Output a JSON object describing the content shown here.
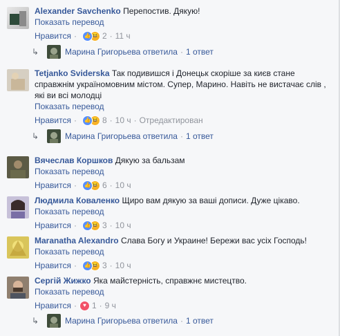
{
  "comments": [
    {
      "author": "Alexander Savchenko",
      "text": "Перепостив. Дякую!",
      "translate": "Показать перевод",
      "like": "Нравится",
      "reactions": [
        "like",
        "haha"
      ],
      "count": "2",
      "time": "11 ч",
      "edited": "",
      "reply": {
        "name": "Марина Григорьева ответила",
        "count": "1 ответ"
      }
    },
    {
      "author": "Tetjanko Sviderska",
      "text": "Так подивишся і Донецьк скоріше за києв стане справжнім україномовним містом. Супер, Марино. Навіть не вистачає слів , які ви всі молодці",
      "translate": "Показать перевод",
      "like": "Нравится",
      "reactions": [
        "like",
        "haha"
      ],
      "count": "8",
      "time": "10 ч",
      "edited": "Отредактирован",
      "reply": {
        "name": "Марина Григорьева ответила",
        "count": "1 ответ"
      }
    },
    {
      "author": "Вячеслав Коршков",
      "text": "Дякую за бальзам",
      "translate": "Показать перевод",
      "like": "Нравится",
      "reactions": [
        "like",
        "haha"
      ],
      "count": "6",
      "time": "10 ч",
      "edited": ""
    },
    {
      "author": "Людмила Коваленко",
      "text": "Щиро вам дякую за ваші дописи. Дуже цікаво.",
      "translate": "Показать перевод",
      "like": "Нравится",
      "reactions": [
        "like",
        "haha"
      ],
      "count": "3",
      "time": "10 ч",
      "edited": ""
    },
    {
      "author": "Maranatha Alexandro",
      "text": "Слава Богу и Украине! Бережи вас усіх Господь!",
      "translate": "Показать перевод",
      "like": "Нравится",
      "reactions": [
        "like",
        "haha"
      ],
      "count": "3",
      "time": "10 ч",
      "edited": ""
    },
    {
      "author": "Сергій Жижко",
      "text": "Яка майстерність, справжнє мистецтво.",
      "translate": "Показать перевод",
      "like": "Нравится",
      "reactions": [
        "love"
      ],
      "count": "1",
      "time": "9 ч",
      "edited": "",
      "reply": {
        "name": "Марина Григорьева ответила",
        "count": "1 ответ"
      }
    }
  ],
  "colors": {
    "link": "#365899",
    "meta": "#90949c",
    "like": "#5890ff",
    "haha": "#f7b125",
    "love": "#f25268"
  },
  "icons": {
    "reply": "reply-arrow-icon",
    "like": "like-reaction-icon",
    "haha": "haha-reaction-icon",
    "love": "love-reaction-icon"
  }
}
